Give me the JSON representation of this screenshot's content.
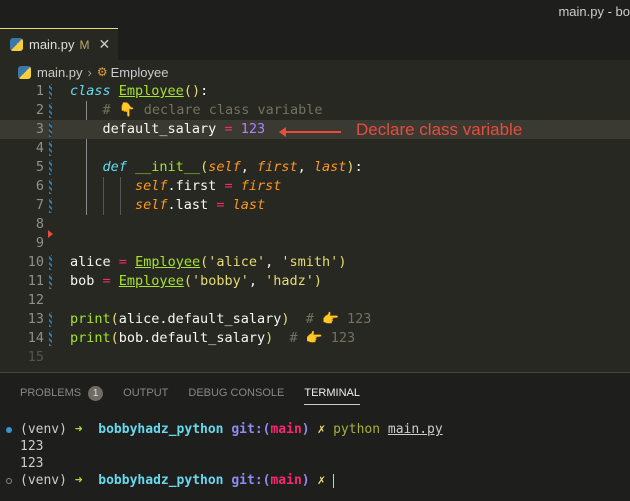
{
  "window": {
    "title": "main.py - bo"
  },
  "tab": {
    "label": "main.py",
    "status": "M",
    "close": "✕"
  },
  "breadcrumb": {
    "file": "main.py",
    "separator": "›",
    "symbol": "Employee"
  },
  "code": {
    "lines": [
      {
        "n": "1"
      },
      {
        "n": "2",
        "comment": "# 👇 declare class variable"
      },
      {
        "n": "3"
      },
      {
        "n": "4"
      },
      {
        "n": "5"
      },
      {
        "n": "6"
      },
      {
        "n": "7"
      },
      {
        "n": "8"
      },
      {
        "n": "9"
      },
      {
        "n": "10"
      },
      {
        "n": "11"
      },
      {
        "n": "12"
      },
      {
        "n": "13",
        "comment": "# 👉 123"
      },
      {
        "n": "14",
        "comment": "# 👉 123"
      },
      {
        "n": "15"
      }
    ]
  },
  "annotation": "Declare class variable",
  "panel": {
    "tabs": [
      {
        "label": "PROBLEMS",
        "badge": "1"
      },
      {
        "label": "OUTPUT"
      },
      {
        "label": "DEBUG CONSOLE"
      },
      {
        "label": "TERMINAL"
      }
    ]
  },
  "terminal": {
    "venv": "(venv)",
    "arrow": "➜",
    "dir": "bobbyhadz_python",
    "git_open": "git:(",
    "branch": "main",
    "git_close": ")",
    "dirty": "✗",
    "cmd": "python",
    "arg": "main.py",
    "outputs": [
      "123",
      "123"
    ]
  },
  "colors": {
    "accent": "#e6db74",
    "annotation": "#e74c3c",
    "background": "#272822"
  }
}
